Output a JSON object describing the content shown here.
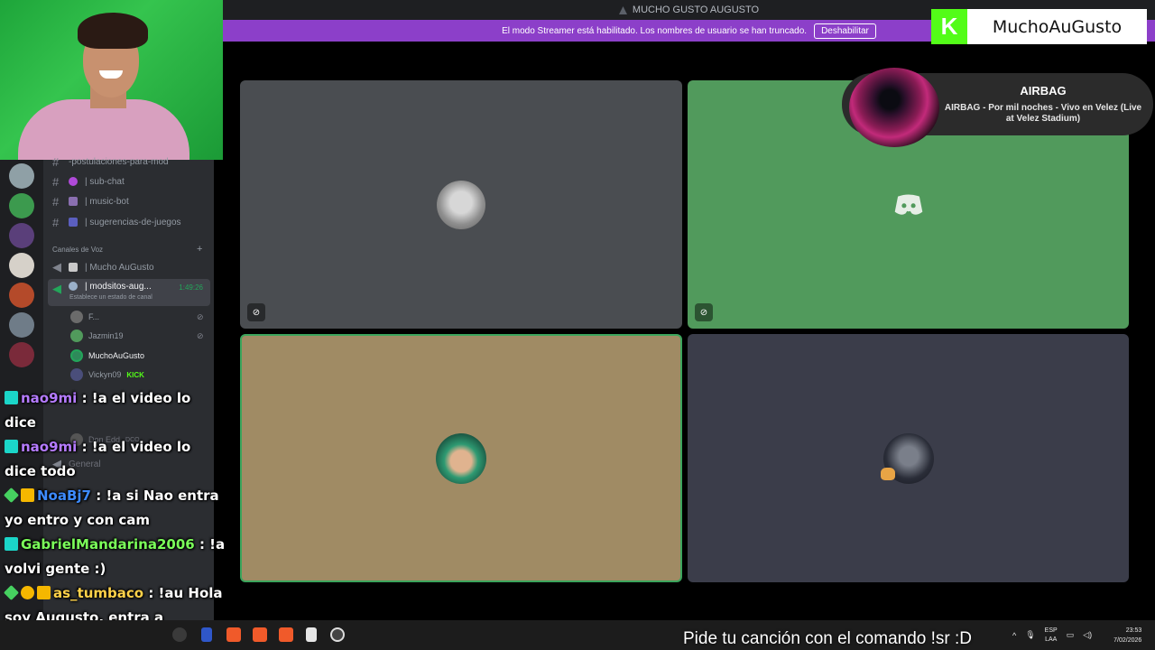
{
  "window": {
    "title": "MUCHO GUSTO AUGUSTO"
  },
  "streamer_banner": {
    "text": "El modo Streamer está habilitado. Los nombres de usuario se han truncado.",
    "button": "Deshabilitar"
  },
  "kick_badge": {
    "channel": "MuchoAuGusto",
    "logo": "K"
  },
  "now_playing": {
    "artist": "AIRBAG",
    "track": "AIRBAG - Por mil noches - Vivo en Velez (Live at Velez Stadium)"
  },
  "sidebar": {
    "text_channels": [
      {
        "label": "-postulaciones-para-mod",
        "icon": "hash-icon"
      },
      {
        "label": "| sub-chat",
        "icon": "heart-icon"
      },
      {
        "label": "| music-bot",
        "icon": "music-note-icon"
      },
      {
        "label": "| sugerencias-de-juegos",
        "icon": "gamepad-icon"
      }
    ],
    "voice_header": "Canales de Voz",
    "voice_channels": [
      {
        "label": "| Mucho AuGusto"
      },
      {
        "label": "| modsitos-aug...",
        "status": "Establece un estado de canal",
        "timer": "1:49:26"
      }
    ],
    "members": [
      {
        "name": "F..."
      },
      {
        "name": "Jazmin19"
      },
      {
        "name": "MuchoAuGusto"
      },
      {
        "name": "Vickyn09",
        "tag": "KICK"
      }
    ],
    "below_members": [
      {
        "name": "Don Edd",
        "tag": "DCO"
      },
      {
        "name": "General"
      }
    ]
  },
  "chat": [
    {
      "user": "nao9mi",
      "color": "#b57bff",
      "text": ": !a el video lo dice"
    },
    {
      "user": "nao9mi",
      "color": "#b57bff",
      "text": ": !a el video lo dice todo"
    },
    {
      "user": "NoaBj7",
      "color": "#3d8bff",
      "text": ": !a si Nao entra yo entro y con cam"
    },
    {
      "user": "GabrielMandarina2006",
      "color": "#7bff5a",
      "text": ": !a volvi gente :)"
    },
    {
      "user": "as_tumbaco",
      "color": "#ffd24a",
      "text": ": !au Hola soy Augusto, entra a cualquier cana de voz y te lo jalo"
    }
  ],
  "song_request": "Pide tu canción con el comando !sr :D",
  "taskbar": {
    "lang": "ESP",
    "region": "LAA",
    "time": "23:53",
    "date": "7/02/2026"
  },
  "colors": {
    "tile_gray": "#4a4d51",
    "tile_green": "#519a5c",
    "tile_tan": "#a08b64",
    "tile_slate": "#3b3d4a",
    "streamer_purple": "#8c3fc9",
    "kick_green": "#53fc18"
  }
}
